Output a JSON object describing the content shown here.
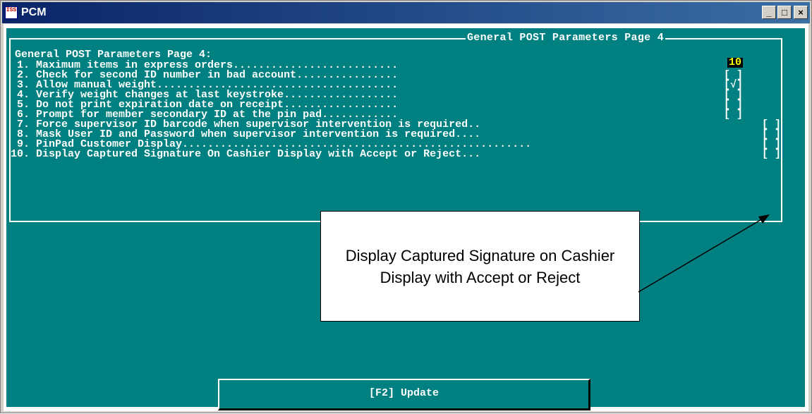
{
  "window": {
    "title": "PCM",
    "app_icon_label": "ISS",
    "buttons": {
      "minimize": "_",
      "maximize": "□",
      "close": "×"
    }
  },
  "screen": {
    "frame_title": "General POST Parameters Page 4",
    "heading": "General POST Parameters Page 4:",
    "rows": [
      {
        "label": " 1. Maximum items in express orders..........................",
        "value": "10"
      },
      {
        "label": " 2. Check for second ID number in bad account................",
        "value": "[ ]"
      },
      {
        "label": " 3. Allow manual weight......................................",
        "value": "[√]"
      },
      {
        "label": " 4. Verify weight changes at last keystroke..................",
        "value": "[ ]"
      },
      {
        "label": " 5. Do not print expiration date on receipt..................",
        "value": "[ ]"
      },
      {
        "label": " 6. Prompt for member secondary ID at the pin pad............",
        "value": "[ ]"
      },
      {
        "label": " 7. Force supervisor ID barcode when supervisor intervention is required..",
        "value": "[ ]"
      },
      {
        "label": " 8. Mask User ID and Password when supervisor intervention is required....",
        "value": "[ ]"
      },
      {
        "label": " 9. PinPad Customer Display.......................................................",
        "value": "[ ]"
      },
      {
        "label": "10. Display Captured Signature On Cashier Display with Accept or Reject...",
        "value": "[ ]"
      }
    ],
    "update_button": "[F2] Update"
  },
  "callout": {
    "text": "Display Captured Signature on Cashier Display with Accept or Reject"
  }
}
